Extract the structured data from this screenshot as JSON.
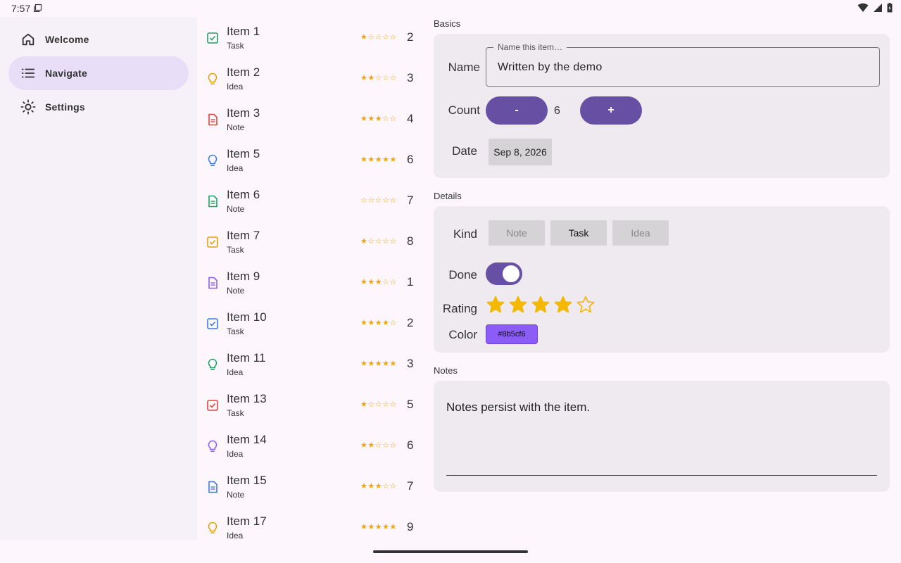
{
  "status_bar": {
    "time": "7:57"
  },
  "nav": {
    "items": [
      {
        "label": "Welcome",
        "icon": "home-icon"
      },
      {
        "label": "Navigate",
        "icon": "list-icon",
        "active": true
      },
      {
        "label": "Settings",
        "icon": "sun-icon"
      }
    ]
  },
  "list": {
    "items": [
      {
        "title": "Item 1",
        "kind": "Task",
        "stars": "★☆☆☆☆",
        "num": "2",
        "color": "#1aa260"
      },
      {
        "title": "Item 2",
        "kind": "Idea",
        "stars": "★★☆☆☆",
        "num": "3",
        "color": "#e6a100"
      },
      {
        "title": "Item 3",
        "kind": "Note",
        "stars": "★★★☆☆",
        "num": "4",
        "color": "#e0443a"
      },
      {
        "title": "Item 5",
        "kind": "Idea",
        "stars": "★★★★★",
        "num": "6",
        "color": "#3b7be0"
      },
      {
        "title": "Item 6",
        "kind": "Note",
        "stars": "☆☆☆☆☆",
        "num": "7",
        "color": "#1aa260"
      },
      {
        "title": "Item 7",
        "kind": "Task",
        "stars": "★☆☆☆☆",
        "num": "8",
        "color": "#e6a100"
      },
      {
        "title": "Item 9",
        "kind": "Note",
        "stars": "★★★☆☆",
        "num": "1",
        "color": "#8b5cf6"
      },
      {
        "title": "Item 10",
        "kind": "Task",
        "stars": "★★★★☆",
        "num": "2",
        "color": "#3b7be0"
      },
      {
        "title": "Item 11",
        "kind": "Idea",
        "stars": "★★★★★",
        "num": "3",
        "color": "#1aa260"
      },
      {
        "title": "Item 13",
        "kind": "Task",
        "stars": "★☆☆☆☆",
        "num": "5",
        "color": "#e0443a"
      },
      {
        "title": "Item 14",
        "kind": "Idea",
        "stars": "★★☆☆☆",
        "num": "6",
        "color": "#8b5cf6"
      },
      {
        "title": "Item 15",
        "kind": "Note",
        "stars": "★★★☆☆",
        "num": "7",
        "color": "#3b7be0"
      },
      {
        "title": "Item 17",
        "kind": "Idea",
        "stars": "★★★★★",
        "num": "9",
        "color": "#e6a100"
      }
    ]
  },
  "basics": {
    "section_label": "Basics",
    "name_label": "Name",
    "name_field_label": "Name this item…",
    "name_value": "Written by the demo",
    "count_label": "Count",
    "minus_label": "-",
    "plus_label": "+",
    "count_value": "6",
    "date_label": "Date",
    "date_value": "Sep 8, 2026"
  },
  "details": {
    "section_label": "Details",
    "kind_label": "Kind",
    "kind_options": [
      "Note",
      "Task",
      "Idea"
    ],
    "kind_selected": "Task",
    "done_label": "Done",
    "done_value": true,
    "rating_label": "Rating",
    "rating_value": 4,
    "rating_max": 5,
    "color_label": "Color",
    "color_value": "#8b5cf6"
  },
  "notes": {
    "section_label": "Notes",
    "text": "Notes persist with the item."
  },
  "colors": {
    "accent": "#6750a4",
    "nav_active": "#e8def8",
    "star": "#f5b800"
  }
}
